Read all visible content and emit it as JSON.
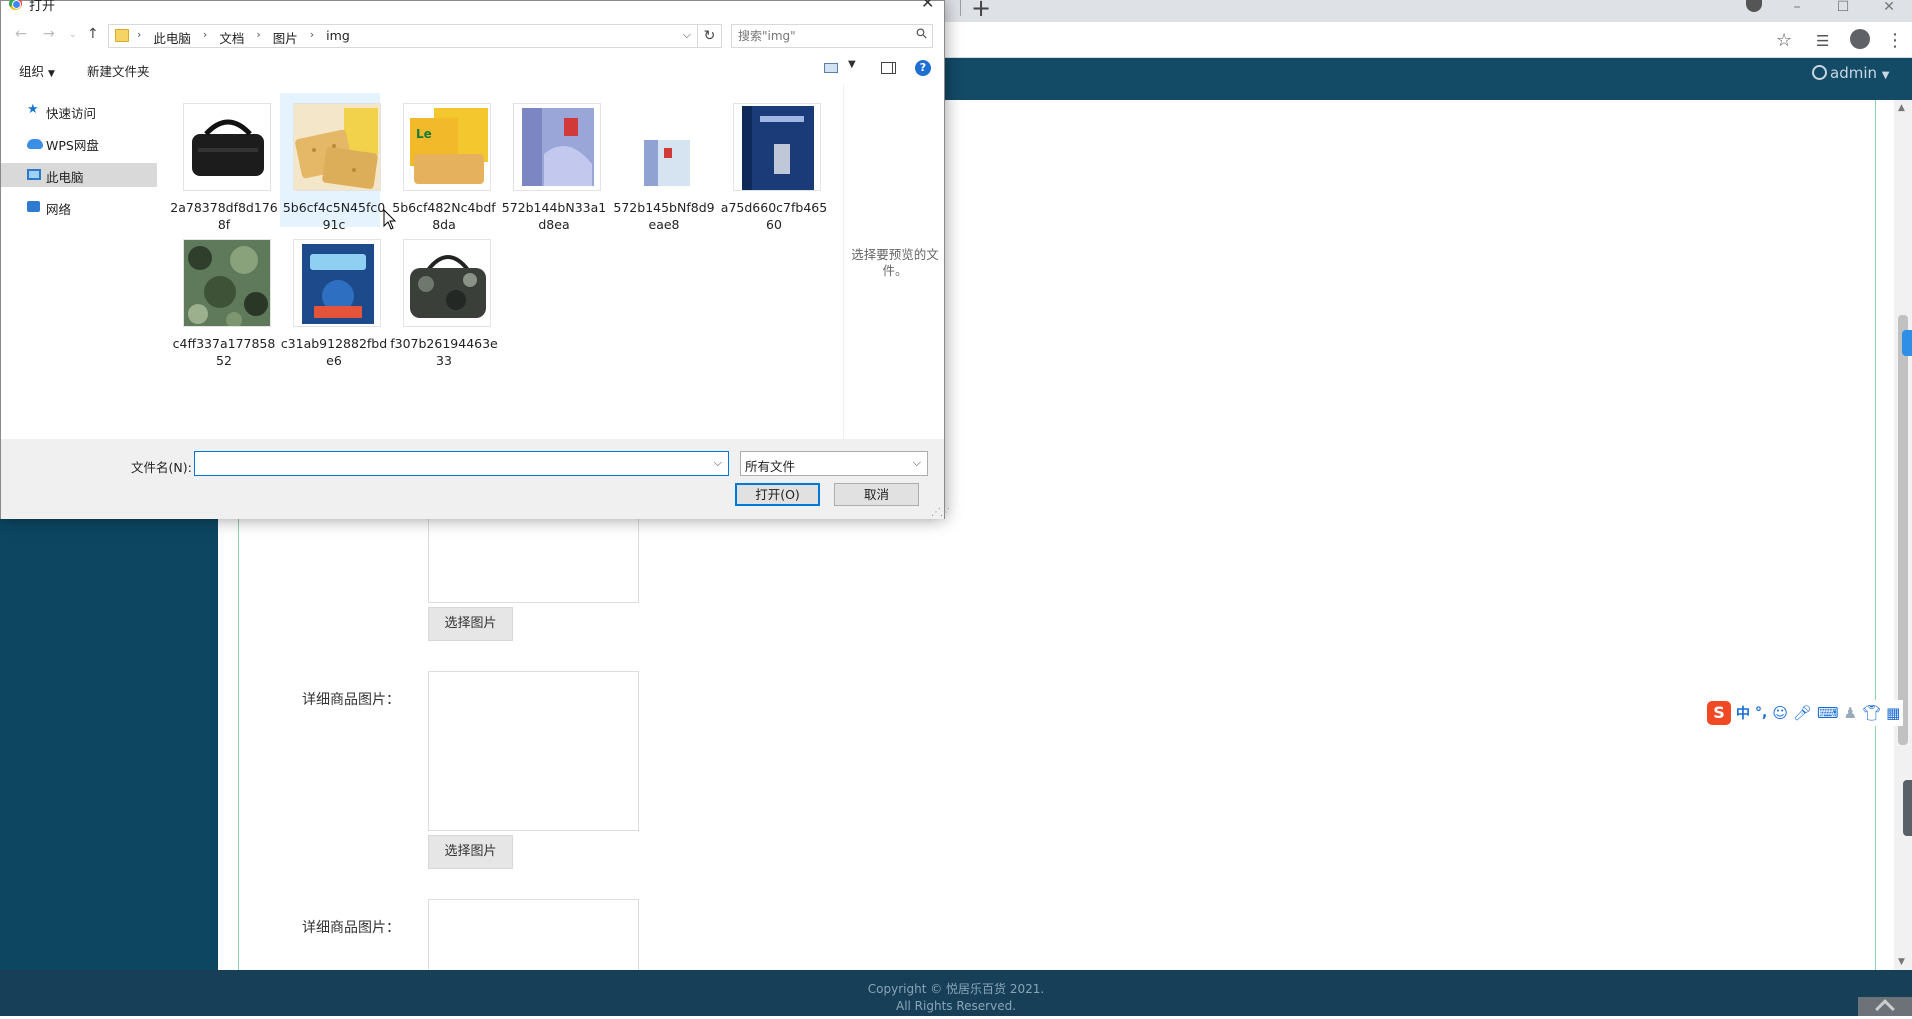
{
  "browser": {
    "new_tab_glyph": "+",
    "window_buttons": [
      "–",
      "☐",
      "✕"
    ],
    "toolbar_icons": [
      "star-icon",
      "reading-list-icon",
      "profile-icon",
      "menu-icon"
    ]
  },
  "app": {
    "admin_label": "admin",
    "form": {
      "upload_button": "选择图片",
      "detail_label_1": "详细商品图片：",
      "detail_button_1": "选择图片",
      "detail_label_2": "详细商品图片："
    },
    "footer": {
      "line1": "Copyright © 悦居乐百货 2021.",
      "line2": "All Rights Reserved."
    }
  },
  "ime": {
    "logo": "S",
    "mode": "中",
    "punct": "°,"
  },
  "dialog": {
    "title": "打开",
    "breadcrumbs": [
      "此电脑",
      "文档",
      "图片",
      "img"
    ],
    "search_placeholder": "搜索\"img\"",
    "toolbar": {
      "organize": "组织",
      "new_folder": "新建文件夹",
      "help": "?"
    },
    "nav_items": [
      {
        "label": "快速访问",
        "icon": "star-icon"
      },
      {
        "label": "WPS网盘",
        "icon": "cloud-icon"
      },
      {
        "label": "此电脑",
        "icon": "computer-icon",
        "selected": true
      },
      {
        "label": "网络",
        "icon": "network-icon"
      }
    ],
    "files": [
      {
        "name": "2a78378df8d1768f",
        "thumb": "black-bag"
      },
      {
        "name": "5b6cf4c5N45fc091c",
        "thumb": "crackers",
        "selected": true
      },
      {
        "name": "5b6cf482Nc4bdf8da",
        "thumb": "lemond-pack"
      },
      {
        "name": "572b144bN33a1d8ea",
        "thumb": "book-blue"
      },
      {
        "name": "572b145bNf8d9eae8",
        "thumb": "book-small"
      },
      {
        "name": "a75d660c7fb46560",
        "thumb": "book-dark"
      },
      {
        "name": "c4ff337a17785852",
        "thumb": "camo-fabric"
      },
      {
        "name": "c31ab912882fbde6",
        "thumb": "book-game"
      },
      {
        "name": "f307b26194463e33",
        "thumb": "camo-bag"
      }
    ],
    "preview_text": "选择要预览的文件。",
    "filename_label": "文件名(N):",
    "filename_value": "",
    "filetype_value": "所有文件",
    "open_button": "打开(O)",
    "cancel_button": "取消"
  }
}
